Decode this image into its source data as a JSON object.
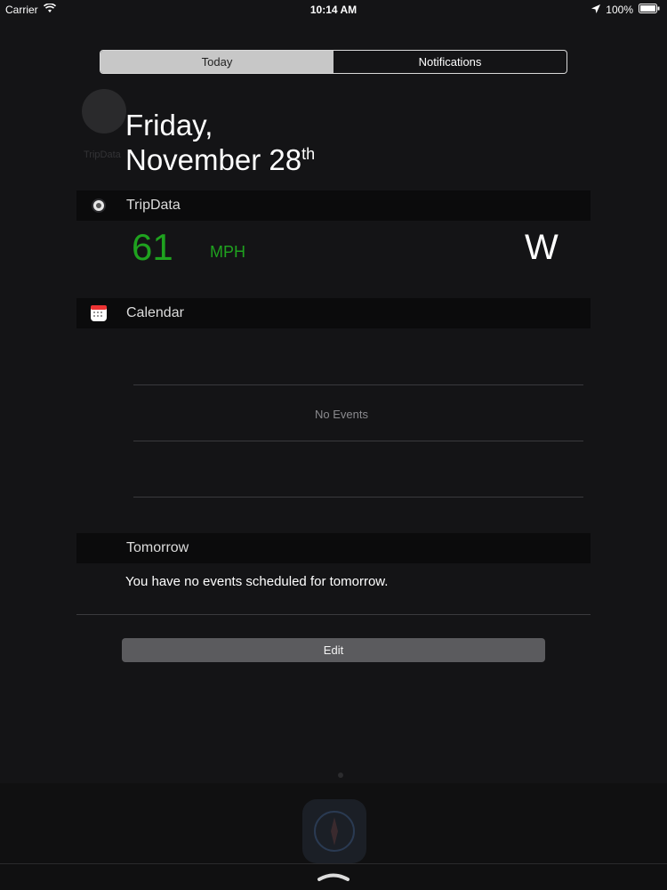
{
  "status_bar": {
    "carrier": "Carrier",
    "time": "10:14 AM",
    "battery": "100%",
    "icons": [
      "wifi-icon",
      "location-arrow-icon",
      "battery-icon"
    ]
  },
  "background": {
    "app_label": "TripData"
  },
  "segmented": {
    "today": "Today",
    "notifications": "Notifications",
    "selected": "Today"
  },
  "date": {
    "weekday": "Friday,",
    "month_day": "November 28",
    "suffix": "th"
  },
  "tripdata": {
    "title": "TripData",
    "speed": "61",
    "unit": "MPH",
    "heading": "W",
    "accent_color": "#1fa21f"
  },
  "calendar": {
    "title": "Calendar",
    "no_events": "No Events"
  },
  "tomorrow": {
    "title": "Tomorrow",
    "message": "You have no events scheduled for tomorrow."
  },
  "edit": {
    "label": "Edit"
  }
}
